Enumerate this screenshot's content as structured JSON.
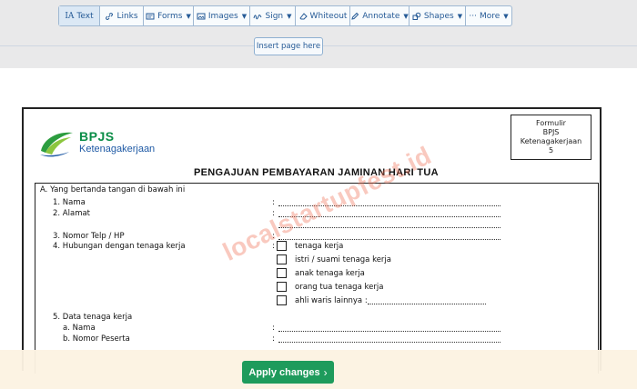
{
  "toolbar": {
    "text": "Text",
    "links": "Links",
    "forms": "Forms",
    "images": "Images",
    "sign": "Sign",
    "whiteout": "Whiteout",
    "annotate": "Annotate",
    "shapes": "Shapes",
    "more": "More"
  },
  "insert_page": "Insert page here",
  "document": {
    "logo_brand": "BPJS",
    "logo_sub": "Ketenagakerjaan",
    "form_box": [
      "Formulir",
      "BPJS",
      "Ketenagakerjaan",
      "5"
    ],
    "title": "PENGAJUAN PEMBAYARAN JAMINAN HARI TUA",
    "section_a": "A. Yang bertanda tangan di bawah ini",
    "item1": "1.  Nama",
    "item2": "2.  Alamat",
    "item3": "3.  Nomor Telp / HP",
    "item4": "4.  Hubungan dengan tenaga kerja",
    "colon": ":",
    "options": [
      "tenaga kerja",
      "istri / suami tenaga kerja",
      "anak tenaga kerja",
      "orang tua tenaga kerja",
      "ahli waris lainnya :"
    ],
    "item5": "5.  Data tenaga kerja",
    "item5a": "a.  Nama",
    "item5b": "b.  Nomor  Peserta"
  },
  "watermark": "localstartupfest.id",
  "apply_button": "Apply changes"
}
